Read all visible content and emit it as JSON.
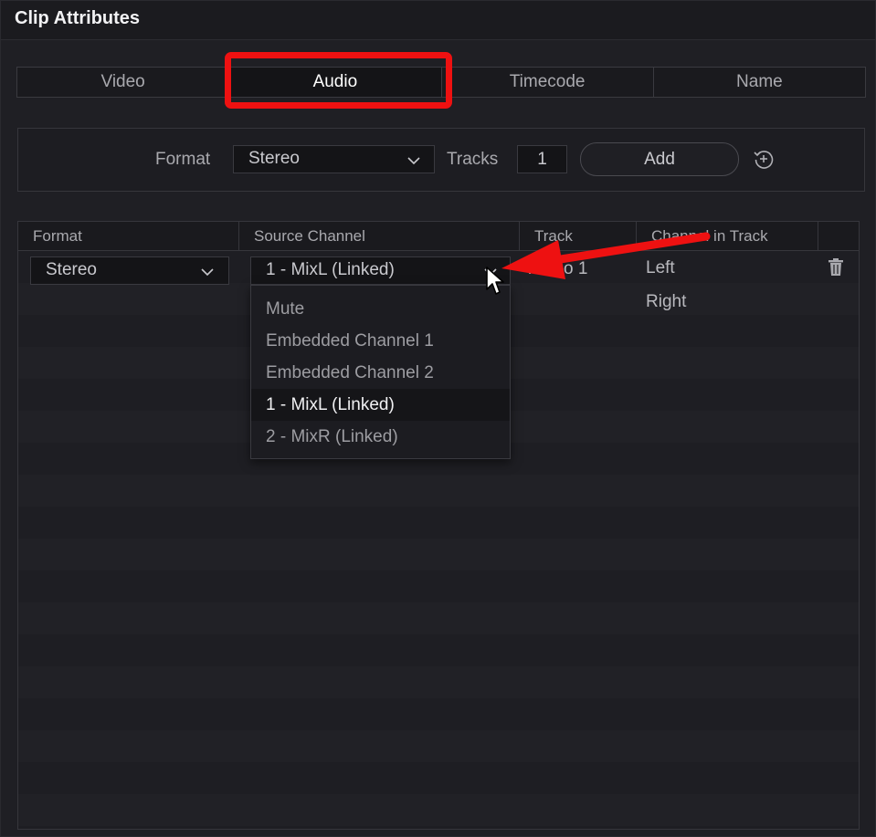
{
  "window": {
    "title": "Clip Attributes"
  },
  "tabs": [
    {
      "label": "Video",
      "active": false
    },
    {
      "label": "Audio",
      "active": true
    },
    {
      "label": "Timecode",
      "active": false
    },
    {
      "label": "Name",
      "active": false
    }
  ],
  "format_panel": {
    "format_label": "Format",
    "format_value": "Stereo",
    "tracks_label": "Tracks",
    "tracks_value": "1",
    "add_label": "Add",
    "reset_icon": "reset-add-icon"
  },
  "table": {
    "headers": [
      "Format",
      "Source Channel",
      "Track",
      "Channel in Track"
    ],
    "row": {
      "format": "Stereo",
      "source_channel": "1 - MixL (Linked)",
      "track": "Audio 1",
      "channels": [
        "Left",
        "Right"
      ],
      "delete_icon": "trash-icon"
    }
  },
  "source_channel_menu": {
    "options": [
      "Mute",
      "Embedded Channel 1",
      "Embedded Channel 2",
      "1 - MixL (Linked)",
      "2 - MixR (Linked)"
    ],
    "selected": "1 - MixL (Linked)"
  },
  "colors": {
    "highlight": "#ee1111",
    "background": "#1f1f24"
  }
}
